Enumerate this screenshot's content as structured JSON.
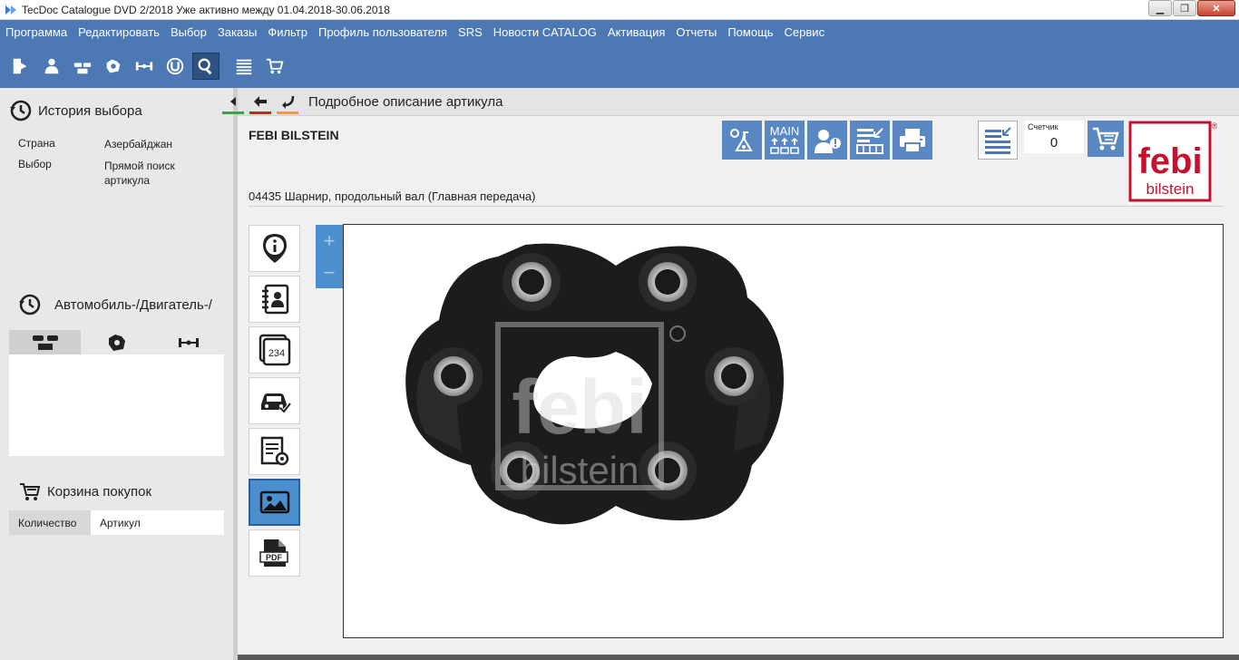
{
  "window": {
    "title": "TecDoc Catalogue DVD   2/2018 Уже активно между 01.04.2018-30.06.2018"
  },
  "menu": [
    "Программа",
    "Редактировать",
    "Выбор",
    "Заказы",
    "Фильтр",
    "Профиль пользователя",
    "SRS",
    "Новости CATALOG",
    "Активация",
    "Отчеты",
    "Помощь",
    "Сервис"
  ],
  "toolbar": {
    "icons": [
      "exit-icon",
      "user-icon",
      "vehicle-icon",
      "engine-icon",
      "axle-icon",
      "universal-icon",
      "search-icon",
      "list-icon",
      "cart-icon"
    ],
    "active": "search-icon"
  },
  "history": {
    "title": "История выбора",
    "rows": [
      {
        "label": "Страна",
        "value": "Азербайджан"
      },
      {
        "label": "Выбор",
        "value": "Прямой поиск артикула"
      }
    ]
  },
  "vehicle": {
    "title": "Автомобиль-/Двигатель-/"
  },
  "cart": {
    "title": "Корзина покупок",
    "col_qty": "Количество",
    "col_article": "Артикул"
  },
  "page": {
    "title": "Подробное описание артикула",
    "brand": "FEBI BILSTEIN",
    "article": "04435 Шарнир, продольный вал (Главная передача)",
    "main_label": "MAIN",
    "counter_label": "Счетчик",
    "counter_value": "0",
    "logo_top": "febi",
    "logo_bottom": "bilstein",
    "logo_mark": "®",
    "tab_number": "234",
    "pdf_label": "PDF"
  },
  "colors": {
    "menu_bg": "#4c78b4",
    "accent": "#4c8fcf",
    "logo_red": "#c8102e"
  }
}
